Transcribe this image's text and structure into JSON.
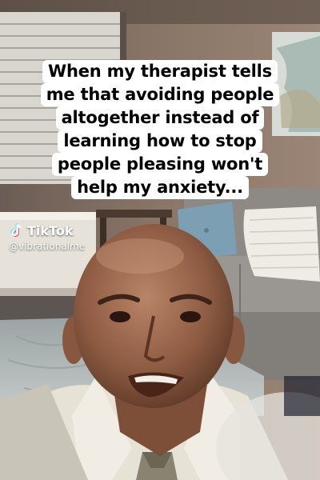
{
  "caption": {
    "lines": [
      "When my therapist tells",
      "me that avoiding people",
      "altogether instead of",
      "learning how to stop",
      "people pleasing won't",
      "help my anxiety..."
    ]
  },
  "watermark": {
    "brand": "TikTok",
    "handle": "@vibrationalme",
    "logo_icon": "tiktok-logo-icon"
  },
  "colors": {
    "caption_bg": "#ffffff",
    "caption_text": "#000000",
    "wall": "#7a6a5e",
    "sofa": "#8d8984",
    "skin": "#9b6a50",
    "shirt": "#e7e2d6"
  }
}
